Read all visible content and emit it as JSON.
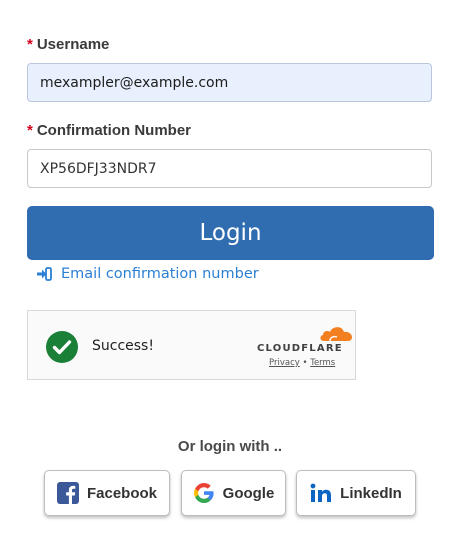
{
  "form": {
    "username_required_mark": "*",
    "username_label": "Username",
    "username_value": "mexampler@example.com",
    "confirmation_required_mark": "*",
    "confirmation_label": "Confirmation Number",
    "confirmation_value": "XP56DFJ33NDR7",
    "login_label": "Login",
    "email_link_label": "Email confirmation number"
  },
  "captcha": {
    "status": "Success!",
    "brand": "CLOUDFLARE",
    "privacy": "Privacy",
    "separator": "•",
    "terms": "Terms"
  },
  "social": {
    "heading": "Or login with ..",
    "buttons": [
      {
        "label": "Facebook",
        "icon": "facebook-icon",
        "color": "#3b5998"
      },
      {
        "label": "Google",
        "icon": "google-icon",
        "color": "#4285f4"
      },
      {
        "label": "LinkedIn",
        "icon": "linkedin-icon",
        "color": "#0a66c2"
      }
    ]
  },
  "colors": {
    "primary": "#2f6db0",
    "link": "#2b7fd4",
    "required": "#d0021b",
    "success": "#1a7f37",
    "cloudflare": "#f38020"
  }
}
